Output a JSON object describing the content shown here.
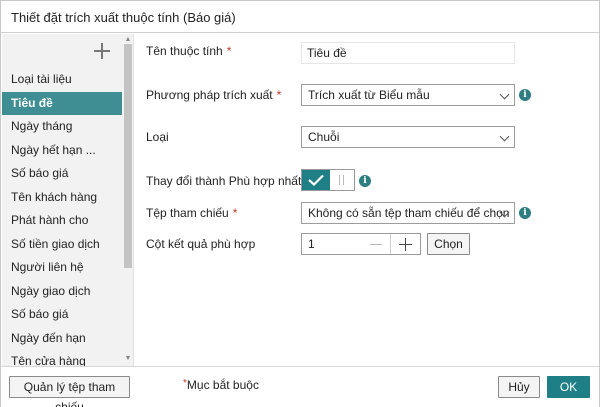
{
  "dialog": {
    "title": "Thiết đặt trích xuất thuộc tính (Báo giá)"
  },
  "sidebar": {
    "items": [
      {
        "label": "Loại tài liệu"
      },
      {
        "label": "Tiêu đề",
        "active": true
      },
      {
        "label": "Ngày tháng"
      },
      {
        "label": "Ngày hết hạn ..."
      },
      {
        "label": "Số báo giá"
      },
      {
        "label": "Tên khách hàng"
      },
      {
        "label": "Phát hành cho"
      },
      {
        "label": "Số tiền giao dịch"
      },
      {
        "label": "Người liên hệ"
      },
      {
        "label": "Ngày giao dịch"
      },
      {
        "label": "Số báo giá"
      },
      {
        "label": "Ngày đến hạn"
      },
      {
        "label": "Tên cửa hàng"
      }
    ]
  },
  "form": {
    "name_label": "Tên thuộc tính",
    "name_value": "Tiêu đề",
    "method_label": "Phương pháp trích xuất",
    "method_value": "Trích xuất từ Biểu mẫu",
    "type_label": "Loại",
    "type_value": "Chuỗi",
    "best_match_label": "Thay đổi thành Phù hợp nhất",
    "best_match_on": true,
    "ref_file_label": "Tệp tham chiếu",
    "ref_file_value": "Không có sẵn tệp tham chiếu để chọn",
    "result_col_label": "Cột kết quả phù hợp",
    "result_col_value": "1",
    "choose_button": "Chọn",
    "required_marker": "*"
  },
  "footer": {
    "manage_button": "Quản lý tệp tham chiếu",
    "required_note": "Mục bắt buộc",
    "required_marker": "*",
    "cancel_button": "Hủy",
    "ok_button": "OK"
  },
  "colors": {
    "accent": "#1f7f86",
    "active_item": "#3f8e93",
    "required": "#c0392b"
  },
  "icons": {
    "add": "plus-icon",
    "info": "info-icon",
    "toggle_on": "check-icon"
  }
}
